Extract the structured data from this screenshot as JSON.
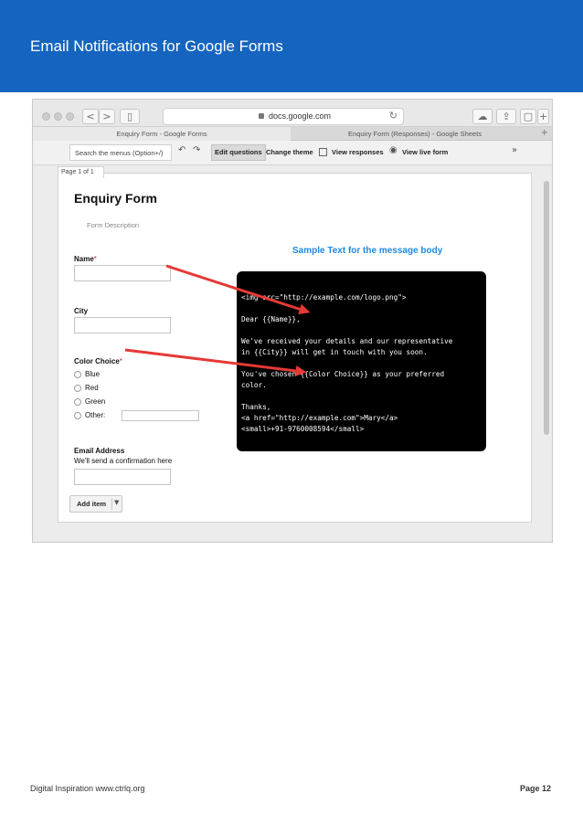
{
  "banner": {
    "title": "Email Notifications for Google Forms"
  },
  "browser": {
    "url": "docs.google.com",
    "tabs": [
      {
        "label": "Enquiry Form - Google Forms",
        "active": true
      },
      {
        "label": "Enquiry Form (Responses) - Google Sheets",
        "active": false
      }
    ],
    "nav_back": "<",
    "nav_forward": ">"
  },
  "form_toolbar": {
    "search_placeholder": "Search the menus (Option+/)",
    "edit_questions": "Edit questions",
    "change_theme": "Change theme",
    "view_responses": "View responses",
    "view_live_form": "View live form"
  },
  "form": {
    "page_indicator": "Page 1 of 1",
    "title": "Enquiry Form",
    "description": "Form Description",
    "questions": [
      {
        "label": "Name",
        "required": true
      },
      {
        "label": "City",
        "required": false
      },
      {
        "label": "Color Choice",
        "required": true,
        "options": [
          "Blue",
          "Red",
          "Green",
          "Other:"
        ]
      },
      {
        "label": "Email Address",
        "required": false,
        "help": "We'll send a confirmation here"
      }
    ],
    "required_mark": "*",
    "add_item": "Add item"
  },
  "sample": {
    "title": "Sample Text for the message body",
    "lines": [
      "<img src=\"http://example.com/logo.png\">",
      "",
      "Dear {{Name}},",
      "",
      "We've received your details and our representative",
      "in {{City}} will get in touch with you soon.",
      "",
      "You've chosen {{Color Choice}} as your preferred",
      "color.",
      "",
      "Thanks,",
      "<a href=\"http://example.com\">Mary</a>",
      "<small>+91-9760008594</small>"
    ]
  },
  "colors": {
    "banner": "#1565c0",
    "arrow": "#e53935",
    "sample_title": "#1e88e5"
  },
  "footer": {
    "left": "Digital Inspiration www.ctrlq.org",
    "right": "Page 12"
  }
}
